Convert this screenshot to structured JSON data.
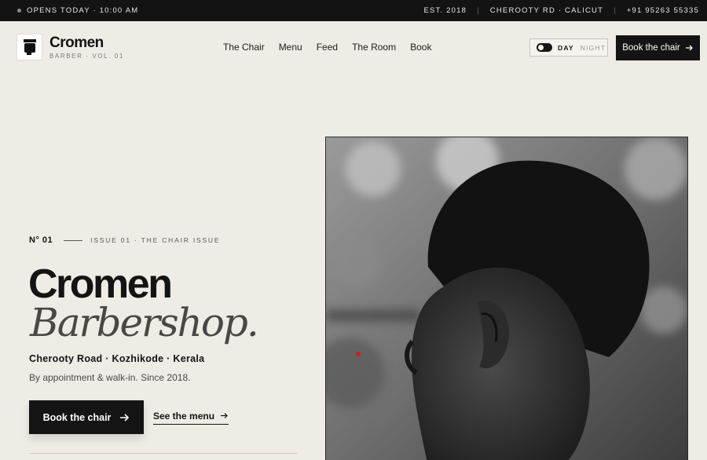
{
  "topbar": {
    "status": "OPENS TODAY · 10:00 AM",
    "est": "EST. 2018",
    "location": "CHEROOTY RD · CALICUT",
    "phone": "+91 95263 55335"
  },
  "header": {
    "brand": "Cromen",
    "brand_sub": "BARBER · VOL. 01",
    "nav": [
      "The Chair",
      "Menu",
      "Feed",
      "The Room",
      "Book"
    ],
    "theme_day": "DAY",
    "theme_night": "NIGHT",
    "cta": "Book the chair"
  },
  "hero": {
    "issue_no": "N° 01",
    "issue_text": "ISSUE 01 · THE CHAIR ISSUE",
    "title_line1": "Cromen",
    "title_line2": "Barbershop.",
    "location": "Cherooty Road · Kozhikode · Kerala",
    "tagline": "By appointment & walk-in. Since 2018.",
    "cta_primary": "Book the chair",
    "cta_secondary": "See the menu"
  },
  "icons": {
    "arrow": "arrow-right-icon",
    "logo": "chair-logo-icon",
    "status_dot": "status-dot-icon"
  }
}
